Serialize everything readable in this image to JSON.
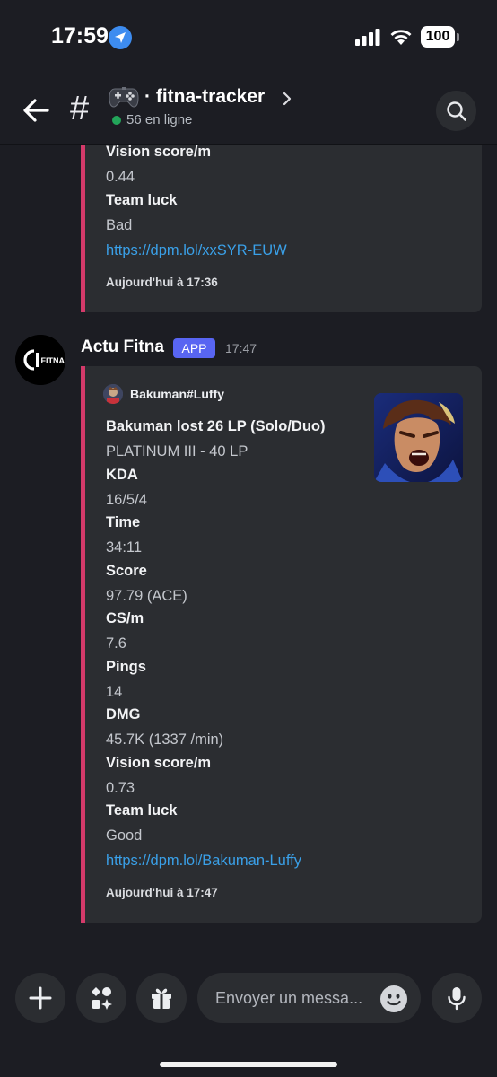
{
  "status_bar": {
    "time": "17:59",
    "battery": "100"
  },
  "header": {
    "channel_name": "· fitna-tracker",
    "online_count": "56 en ligne"
  },
  "previous_embed": {
    "fields": [
      {
        "name": "Vision score/m",
        "value": "0.44"
      },
      {
        "name": "Team luck",
        "value": "Bad"
      }
    ],
    "link": "https://dpm.lol/xxSYR-EUW",
    "footer": "Aujourd'hui à 17:36"
  },
  "message": {
    "author": "Actu Fitna",
    "badge": "APP",
    "time": "17:47",
    "avatar_text": "FITNA",
    "embed": {
      "author_name": "Bakuman#Luffy",
      "title": "Bakuman lost 26 LP (Solo/Duo)",
      "rank": "PLATINUM III - 40 LP",
      "fields": [
        {
          "name": "KDA",
          "value": "16/5/4"
        },
        {
          "name": "Time",
          "value": "34:11"
        },
        {
          "name": "Score",
          "value": "97.79 (ACE)"
        },
        {
          "name": "CS/m",
          "value": "7.6"
        },
        {
          "name": "Pings",
          "value": "14"
        },
        {
          "name": "DMG",
          "value": "45.7K (1337 /min)"
        },
        {
          "name": "Vision score/m",
          "value": "0.73"
        },
        {
          "name": "Team luck",
          "value": "Good"
        }
      ],
      "link": "https://dpm.lol/Bakuman-Luffy",
      "footer": "Aujourd'hui à 17:47",
      "accent_color": "#d43a6a"
    }
  },
  "composer": {
    "placeholder": "Envoyer un messa..."
  },
  "icons": {
    "status": [
      "location-icon",
      "signal-icon",
      "wifi-icon",
      "battery-icon"
    ],
    "header": [
      "back-arrow-icon",
      "hash-icon",
      "gamepad-icon",
      "chevron-right-icon",
      "search-icon"
    ],
    "composer": [
      "plus-icon",
      "apps-icon",
      "gift-icon",
      "emoji-icon",
      "microphone-icon"
    ]
  },
  "colors": {
    "background": "#1c1d23",
    "embed": "#2b2d31",
    "link": "#3aa0e8",
    "badge": "#5865f2",
    "online": "#23a55a"
  }
}
